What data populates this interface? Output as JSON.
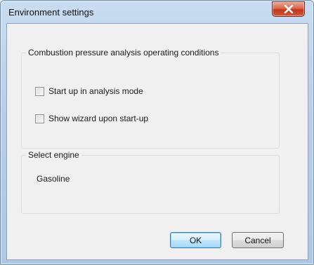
{
  "window": {
    "title": "Environment settings"
  },
  "title_bar": {
    "close_icon": "close-icon"
  },
  "combustion_group": {
    "label": "Combustion pressure analysis operating conditions",
    "options": [
      {
        "label": "Start up in analysis mode",
        "checked": false
      },
      {
        "label": "Show wizard upon start-up",
        "checked": false
      }
    ]
  },
  "engine_group": {
    "label": "Select engine",
    "value": "Gasoline"
  },
  "buttons": {
    "ok": "OK",
    "cancel": "Cancel"
  }
}
